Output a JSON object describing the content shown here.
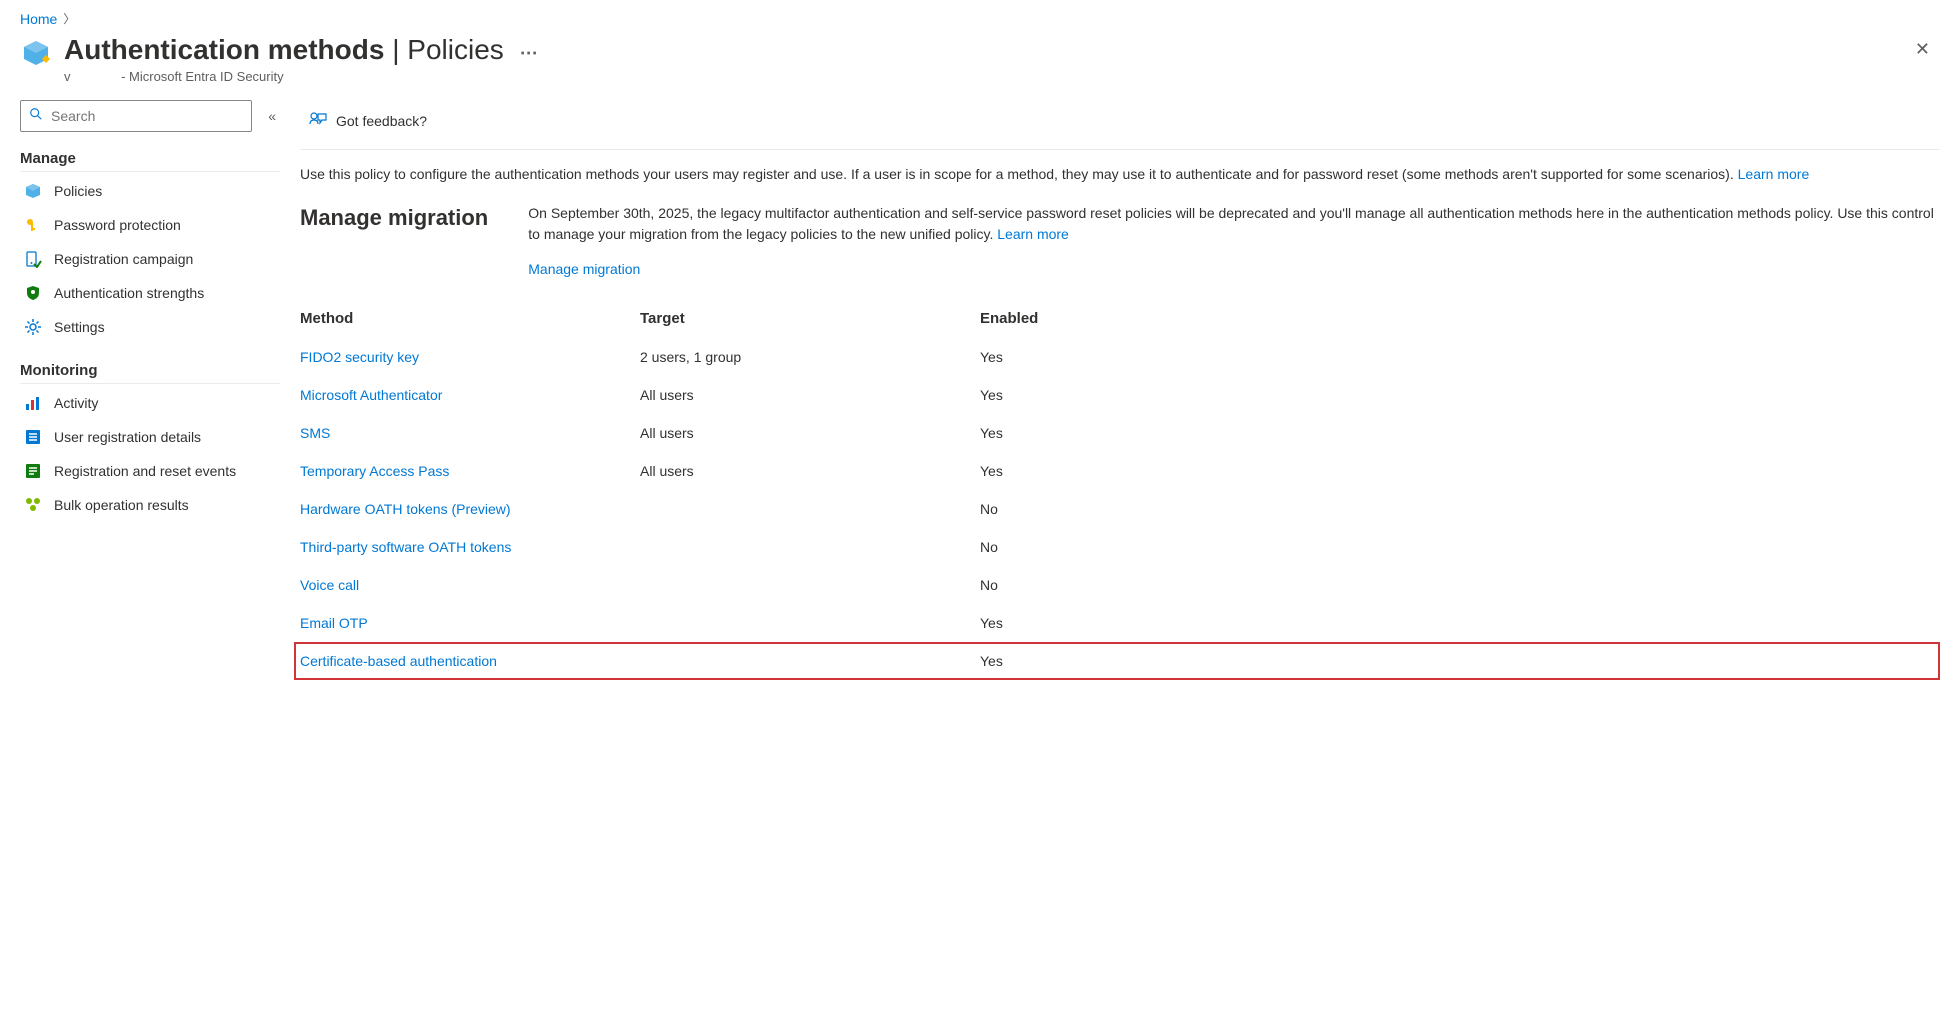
{
  "breadcrumb": {
    "home": "Home"
  },
  "header": {
    "title_main": "Authentication methods",
    "title_sep": " | ",
    "title_sub": "Policies",
    "subtitle_prefix": "v",
    "subtitle_rest": "- Microsoft Entra ID Security"
  },
  "search": {
    "placeholder": "Search"
  },
  "sidebar": {
    "groups": [
      {
        "title": "Manage",
        "items": [
          {
            "label": "Policies",
            "icon": "policies-icon"
          },
          {
            "label": "Password protection",
            "icon": "key-icon"
          },
          {
            "label": "Registration campaign",
            "icon": "campaign-icon"
          },
          {
            "label": "Authentication strengths",
            "icon": "shield-icon"
          },
          {
            "label": "Settings",
            "icon": "gear-icon"
          }
        ]
      },
      {
        "title": "Monitoring",
        "items": [
          {
            "label": "Activity",
            "icon": "chart-icon"
          },
          {
            "label": "User registration details",
            "icon": "list-icon"
          },
          {
            "label": "Registration and reset events",
            "icon": "events-icon"
          },
          {
            "label": "Bulk operation results",
            "icon": "bulk-icon"
          }
        ]
      }
    ]
  },
  "toolbar": {
    "feedback": "Got feedback?"
  },
  "main": {
    "description": "Use this policy to configure the authentication methods your users may register and use. If a user is in scope for a method, they may use it to authenticate and for password reset (some methods aren't supported for some scenarios).",
    "learn_more": "Learn more",
    "migration": {
      "heading": "Manage migration",
      "body": "On September 30th, 2025, the legacy multifactor authentication and self-service password reset policies will be deprecated and you'll manage all authentication methods here in the authentication methods policy. Use this control to manage your migration from the legacy policies to the new unified policy.",
      "learn_more": "Learn more",
      "link": "Manage migration"
    },
    "table": {
      "headers": {
        "method": "Method",
        "target": "Target",
        "enabled": "Enabled"
      },
      "rows": [
        {
          "method": "FIDO2 security key",
          "target": "2 users, 1 group",
          "enabled": "Yes",
          "highlight": false
        },
        {
          "method": "Microsoft Authenticator",
          "target": "All users",
          "enabled": "Yes",
          "highlight": false
        },
        {
          "method": "SMS",
          "target": "All users",
          "enabled": "Yes",
          "highlight": false
        },
        {
          "method": "Temporary Access Pass",
          "target": "All users",
          "enabled": "Yes",
          "highlight": false
        },
        {
          "method": "Hardware OATH tokens (Preview)",
          "target": "",
          "enabled": "No",
          "highlight": false
        },
        {
          "method": "Third-party software OATH tokens",
          "target": "",
          "enabled": "No",
          "highlight": false
        },
        {
          "method": "Voice call",
          "target": "",
          "enabled": "No",
          "highlight": false
        },
        {
          "method": "Email OTP",
          "target": "",
          "enabled": "Yes",
          "highlight": false
        },
        {
          "method": "Certificate-based authentication",
          "target": "",
          "enabled": "Yes",
          "highlight": true
        }
      ]
    }
  }
}
